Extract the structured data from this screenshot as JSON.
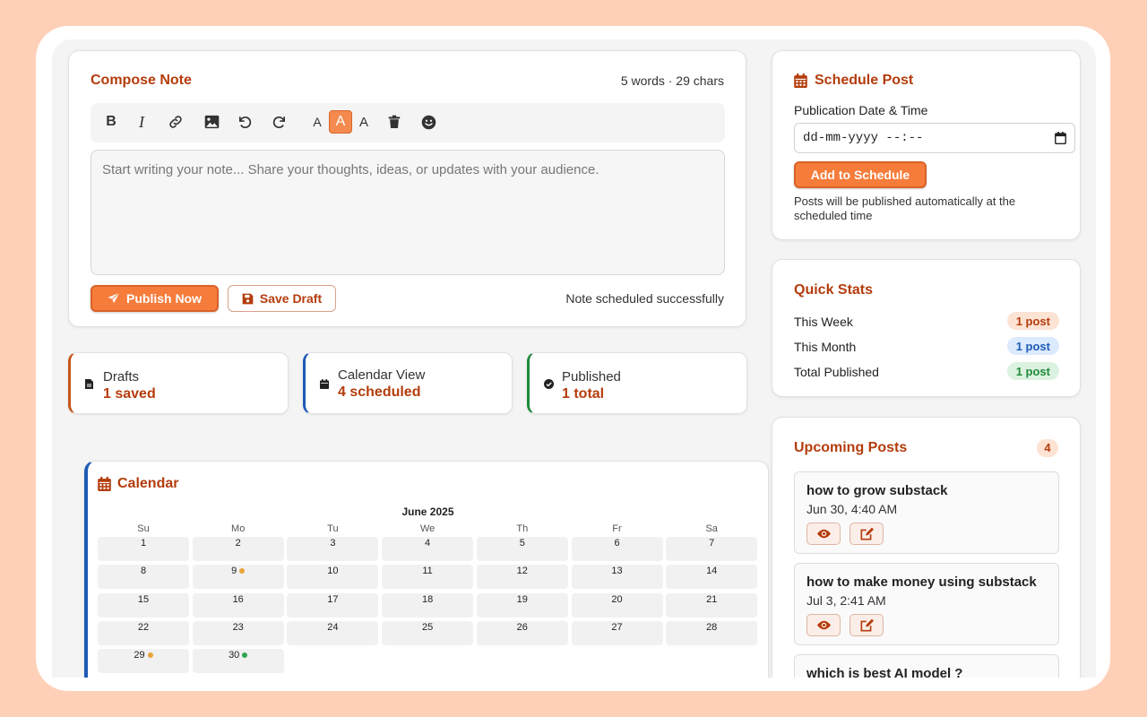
{
  "compose": {
    "title": "Compose Note",
    "counter": "5 words · 29 chars",
    "toolbar": [
      "bold-icon",
      "italic-icon",
      "link-icon",
      "image-icon",
      "undo-icon",
      "redo-icon",
      "font-small",
      "font-medium",
      "font-large",
      "trash-icon",
      "emoji-icon"
    ],
    "font_sizes": {
      "small": "A",
      "medium": "A",
      "large": "A"
    },
    "placeholder": "Start writing your note... Share your thoughts, ideas, or updates with your audience.",
    "publish_label": "Publish Now",
    "draft_label": "Save Draft",
    "status": "Note scheduled successfully"
  },
  "stats": [
    {
      "label": "Drafts",
      "value": "1 saved",
      "color": "#c8561e"
    },
    {
      "label": "Calendar View",
      "value": "4 scheduled",
      "color": "#1f5bb5"
    },
    {
      "label": "Published",
      "value": "1 total",
      "color": "#1f8a3a"
    }
  ],
  "calendar": {
    "title": "Calendar",
    "month": "June 2025",
    "weekdays": [
      "Su",
      "Mo",
      "Tu",
      "We",
      "Th",
      "Fr",
      "Sa"
    ],
    "weeks": [
      [
        "1",
        "2",
        "3",
        "4",
        "5",
        "6",
        "7"
      ],
      [
        "8",
        "9",
        "10",
        "11",
        "12",
        "13",
        "14"
      ],
      [
        "15",
        "16",
        "17",
        "18",
        "19",
        "20",
        "21"
      ],
      [
        "22",
        "23",
        "24",
        "25",
        "26",
        "27",
        "28"
      ],
      [
        "29",
        "30"
      ]
    ],
    "marked_days": {
      "9": "#e8a33a",
      "29": "#e8a33a",
      "30": "#2fa84f"
    }
  },
  "schedule": {
    "title": "Schedule Post",
    "field_label": "Publication Date & Time",
    "date_placeholder": "dd-mm-yyyy --:--",
    "button": "Add to Schedule",
    "note": "Posts will be published automatically at the scheduled time"
  },
  "quick_stats": {
    "title": "Quick Stats",
    "rows": [
      {
        "label": "This Week",
        "value": "1 post",
        "bg": "#fde3d3",
        "fg": "#b43c0c"
      },
      {
        "label": "This Month",
        "value": "1 post",
        "bg": "#dbeafd",
        "fg": "#1f5bb5"
      },
      {
        "label": "Total Published",
        "value": "1 post",
        "bg": "#dcf2e0",
        "fg": "#1f8a3a"
      }
    ]
  },
  "upcoming": {
    "title": "Upcoming Posts",
    "count": "4",
    "posts": [
      {
        "title": "how to grow substack",
        "date": "Jun 30, 4:40 AM"
      },
      {
        "title": "how to make money using substack",
        "date": "Jul 3, 2:41 AM"
      },
      {
        "title": "which is best AI model ?",
        "date": ""
      }
    ]
  },
  "accent": "#f57c3a",
  "brand_text": "#b43c0c"
}
